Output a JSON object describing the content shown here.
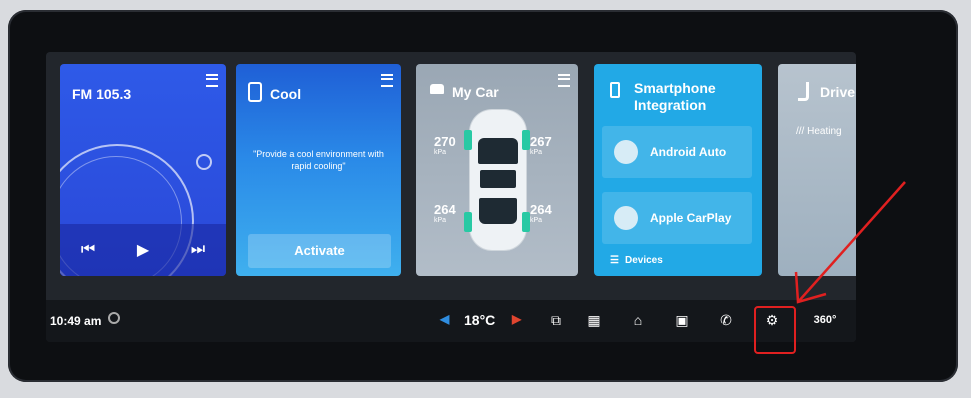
{
  "cards": {
    "radio": {
      "title": "FM 105.3",
      "prev": "⏮",
      "play": "▶",
      "next": "⏭"
    },
    "cool": {
      "title": "Cool",
      "quote": "\"Provide a cool environment with rapid cooling\"",
      "button": "Activate"
    },
    "mycar": {
      "title": "My Car",
      "tires": [
        {
          "value": "270",
          "unit": "kPa"
        },
        {
          "value": "267",
          "unit": "kPa"
        },
        {
          "value": "264",
          "unit": "kPa"
        },
        {
          "value": "264",
          "unit": "kPa"
        }
      ]
    },
    "phone": {
      "title_line1": "Smartphone",
      "title_line2": "Integration",
      "btn1": "Android Auto",
      "btn2": "Apple CarPlay",
      "devices": "Devices"
    },
    "driver": {
      "title": "Drive",
      "sub": "/// Heating"
    }
  },
  "statusbar": {
    "time": "10:49 am",
    "temp_left": "◀",
    "temp": "18°C",
    "temp_right": "▶",
    "icons": {
      "multiwindow": "⧉",
      "grid": "▦",
      "home": "⌂",
      "apps": "▣",
      "phone": "✆",
      "settings": "⚙",
      "view360": "360°"
    }
  },
  "colors": {
    "annotation": "#e02020",
    "tire_accent": "#28c9a4"
  }
}
